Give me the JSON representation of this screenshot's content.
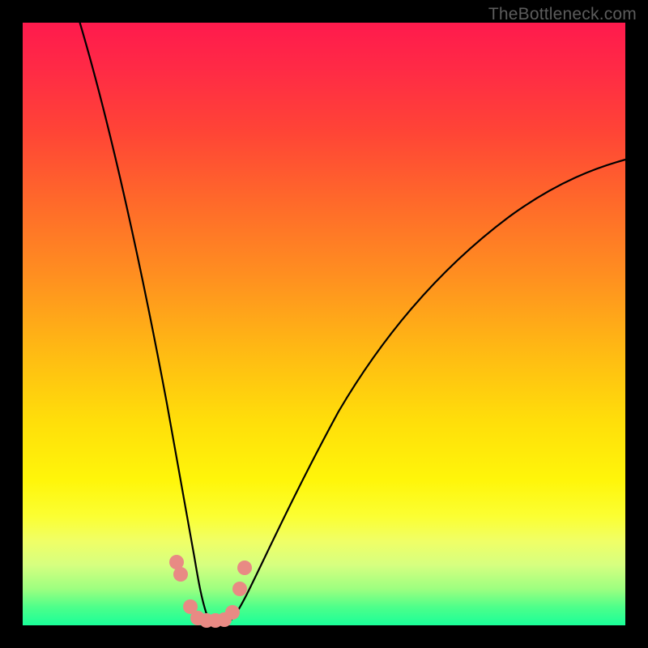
{
  "watermark": "TheBottleneck.com",
  "colors": {
    "frame": "#000000",
    "gradient_top": "#ff1a4d",
    "gradient_bottom": "#1aff99",
    "curve": "#000000",
    "dots": "#e88a84"
  },
  "chart_data": {
    "type": "line",
    "title": "",
    "xlabel": "",
    "ylabel": "",
    "xlim": [
      0,
      100
    ],
    "ylim": [
      0,
      100
    ],
    "note": "Values estimated from pixel positions; no axis labels present in image.",
    "series": [
      {
        "name": "left-branch",
        "x": [
          9,
          12,
          15,
          18,
          20,
          22,
          24,
          25,
          26,
          27,
          28,
          29,
          30
        ],
        "y": [
          100,
          84,
          66,
          48,
          36,
          25,
          14,
          9,
          6,
          4,
          2,
          1,
          0
        ]
      },
      {
        "name": "right-branch",
        "x": [
          34,
          36,
          38,
          41,
          45,
          50,
          56,
          63,
          71,
          80,
          90,
          100
        ],
        "y": [
          0,
          3,
          6,
          11,
          19,
          28,
          38,
          48,
          57,
          65,
          72,
          78
        ]
      }
    ],
    "dots": [
      {
        "x": 25.5,
        "y": 10.5
      },
      {
        "x": 26.2,
        "y": 8.5
      },
      {
        "x": 27.8,
        "y": 3.0
      },
      {
        "x": 29.0,
        "y": 1.2
      },
      {
        "x": 30.5,
        "y": 0.8
      },
      {
        "x": 32.0,
        "y": 0.8
      },
      {
        "x": 33.5,
        "y": 1.0
      },
      {
        "x": 34.8,
        "y": 2.2
      },
      {
        "x": 36.0,
        "y": 6.0
      },
      {
        "x": 36.8,
        "y": 9.5
      }
    ]
  }
}
